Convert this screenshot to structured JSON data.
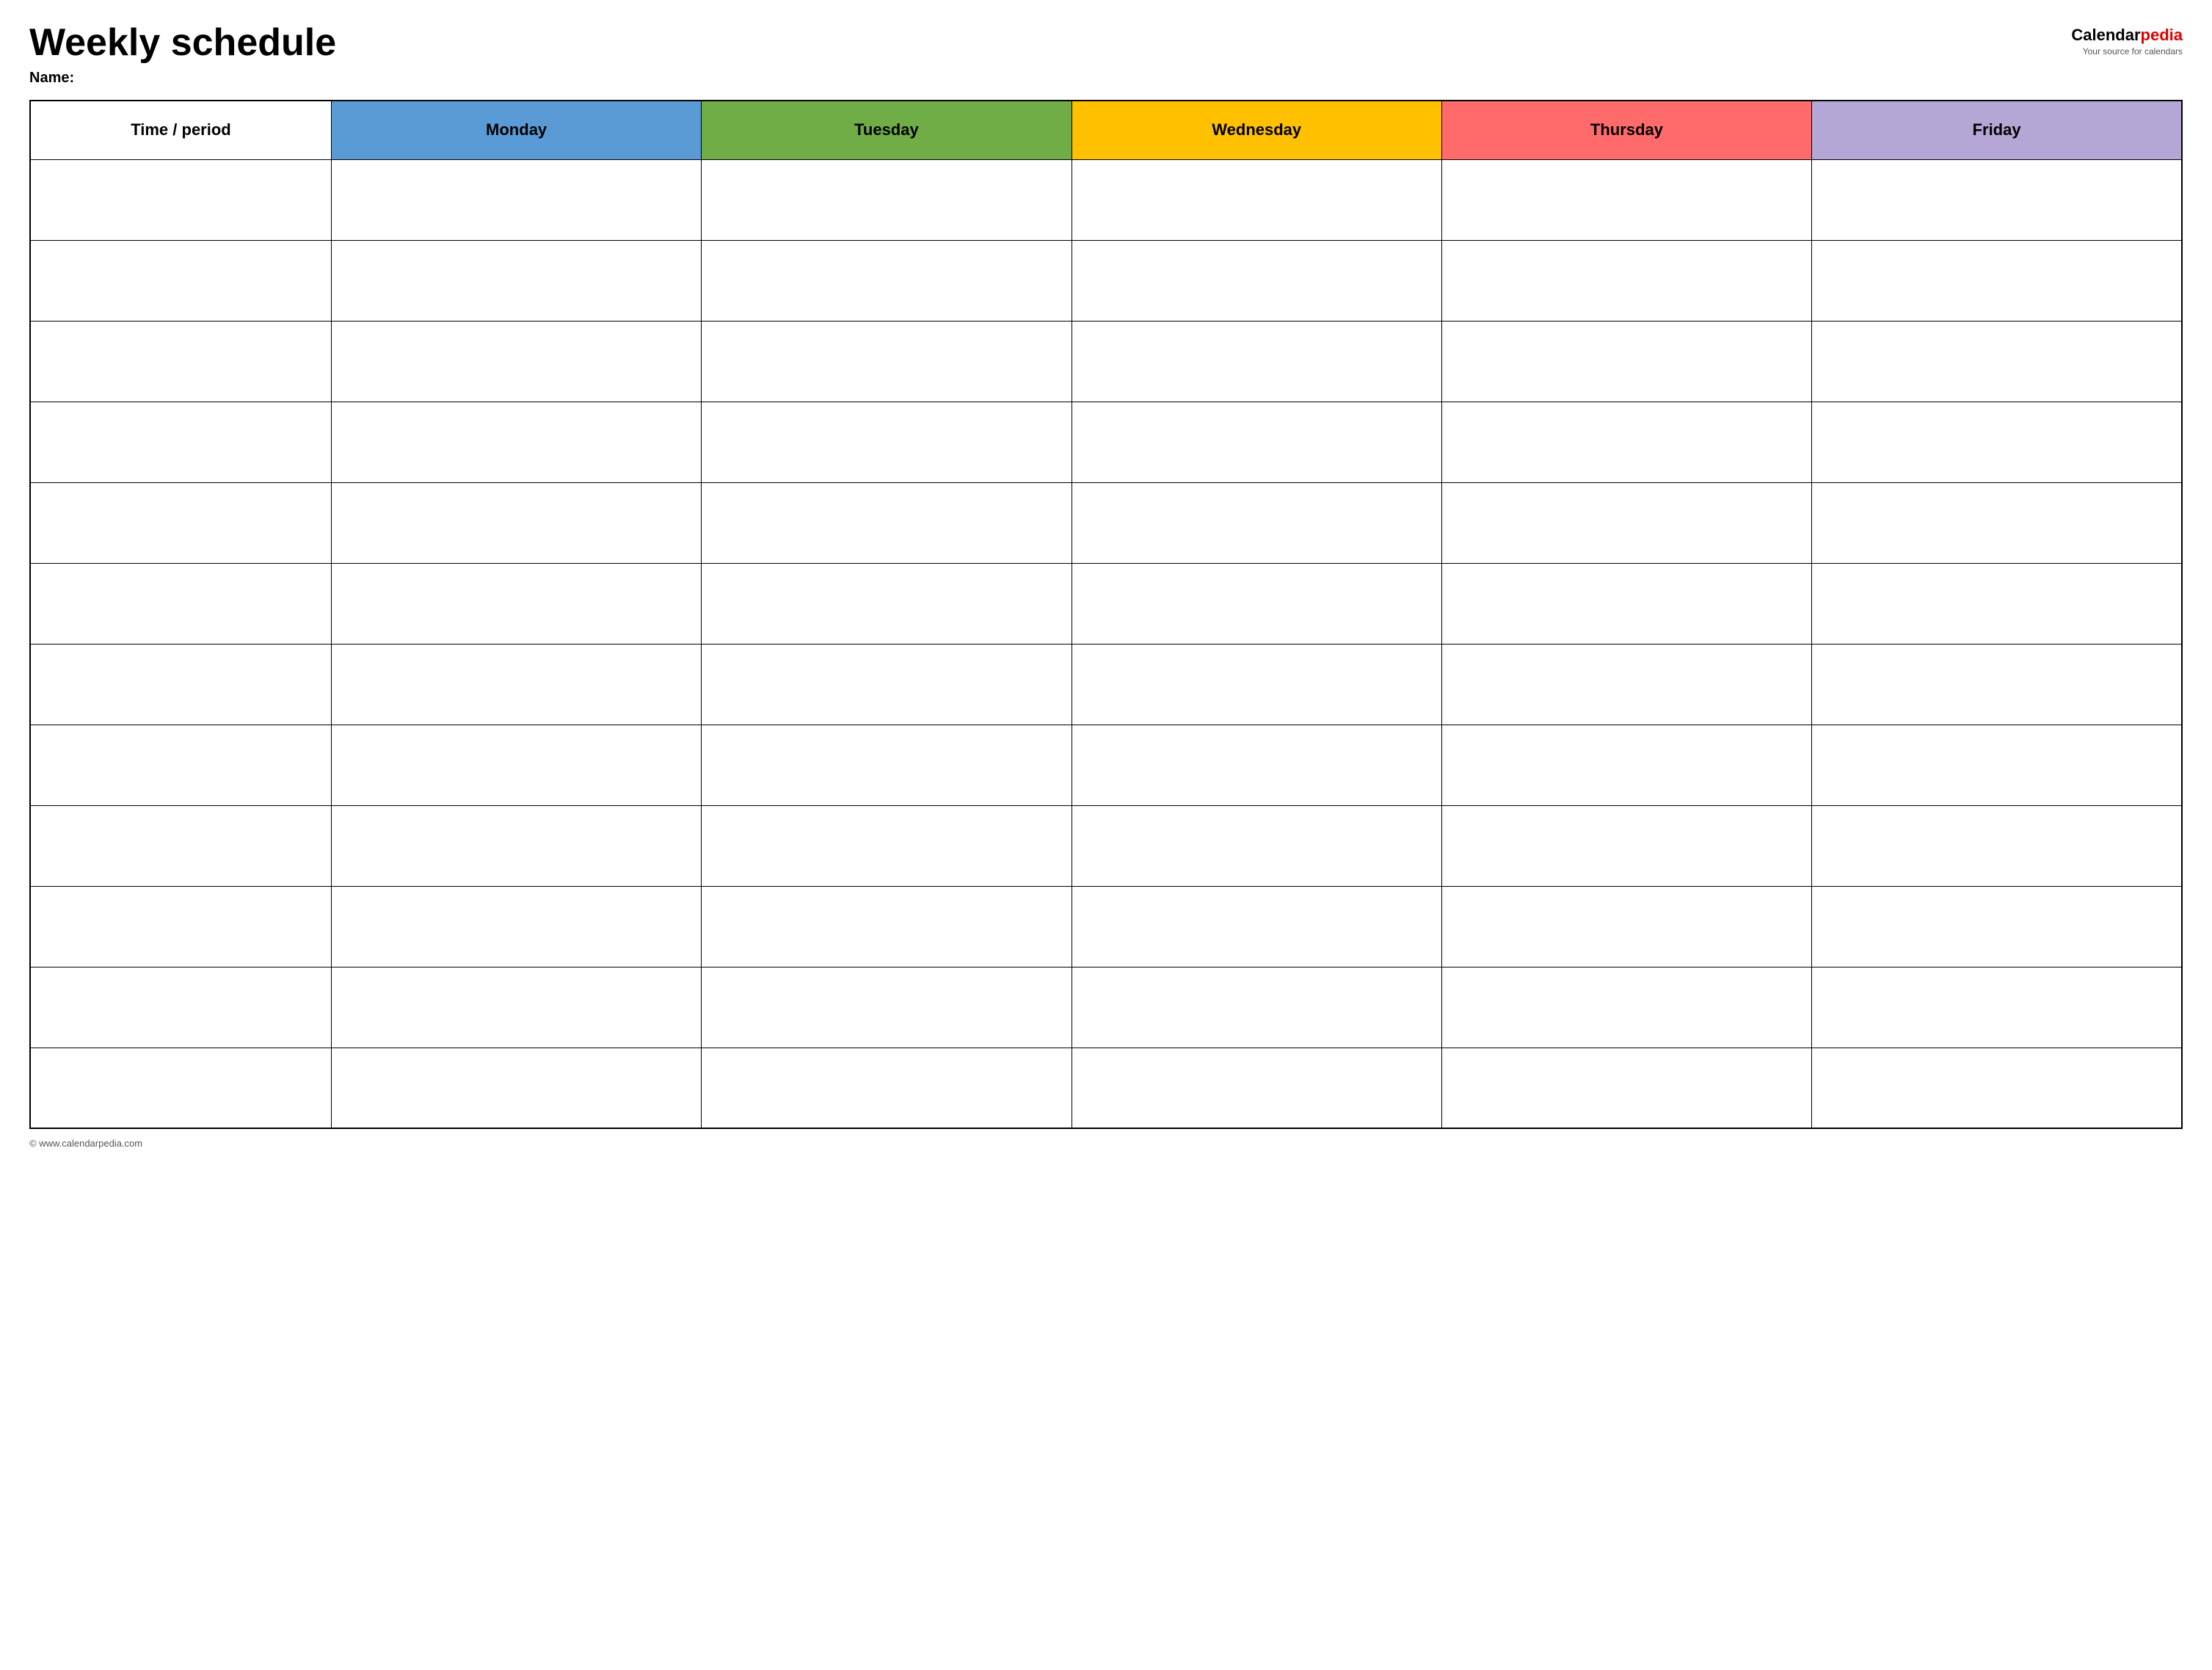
{
  "header": {
    "title": "Weekly schedule",
    "name_label": "Name:",
    "logo_calendar": "Calendar",
    "logo_pedia": "pedia",
    "logo_tagline": "Your source for calendars"
  },
  "table": {
    "columns": [
      {
        "key": "time",
        "label": "Time / period",
        "color": "#ffffff",
        "class": "th-time"
      },
      {
        "key": "monday",
        "label": "Monday",
        "color": "#5b9bd5",
        "class": "th-monday"
      },
      {
        "key": "tuesday",
        "label": "Tuesday",
        "color": "#70ad47",
        "class": "th-tuesday"
      },
      {
        "key": "wednesday",
        "label": "Wednesday",
        "color": "#ffc000",
        "class": "th-wednesday"
      },
      {
        "key": "thursday",
        "label": "Thursday",
        "color": "#ff6b6b",
        "class": "th-thursday"
      },
      {
        "key": "friday",
        "label": "Friday",
        "color": "#b4a7d6",
        "class": "th-friday"
      }
    ],
    "row_count": 12
  },
  "footer": {
    "url": "© www.calendarpedia.com"
  }
}
